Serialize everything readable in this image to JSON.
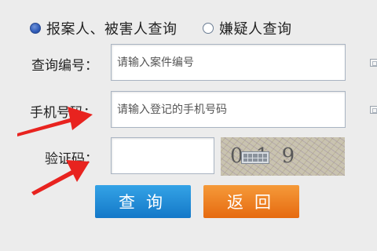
{
  "radios": [
    {
      "label": "报案人、被害人查询",
      "checked": true
    },
    {
      "label": "嫌疑人查询",
      "checked": false
    }
  ],
  "form": {
    "case_no_label": "查询编号：",
    "case_no_placeholder": "请输入案件编号",
    "phone_label": "手机号码：",
    "phone_placeholder": "请输入登记的手机号码",
    "captcha_label": "验证码：",
    "captcha_value": ""
  },
  "captcha_image": {
    "text": "0    1 9",
    "icon": "keyboard-icon"
  },
  "buttons": {
    "query": "查询",
    "back": "返回"
  },
  "colors": {
    "query": "#1e88d6",
    "back": "#ee7a20",
    "arrow": "#e8231f"
  }
}
